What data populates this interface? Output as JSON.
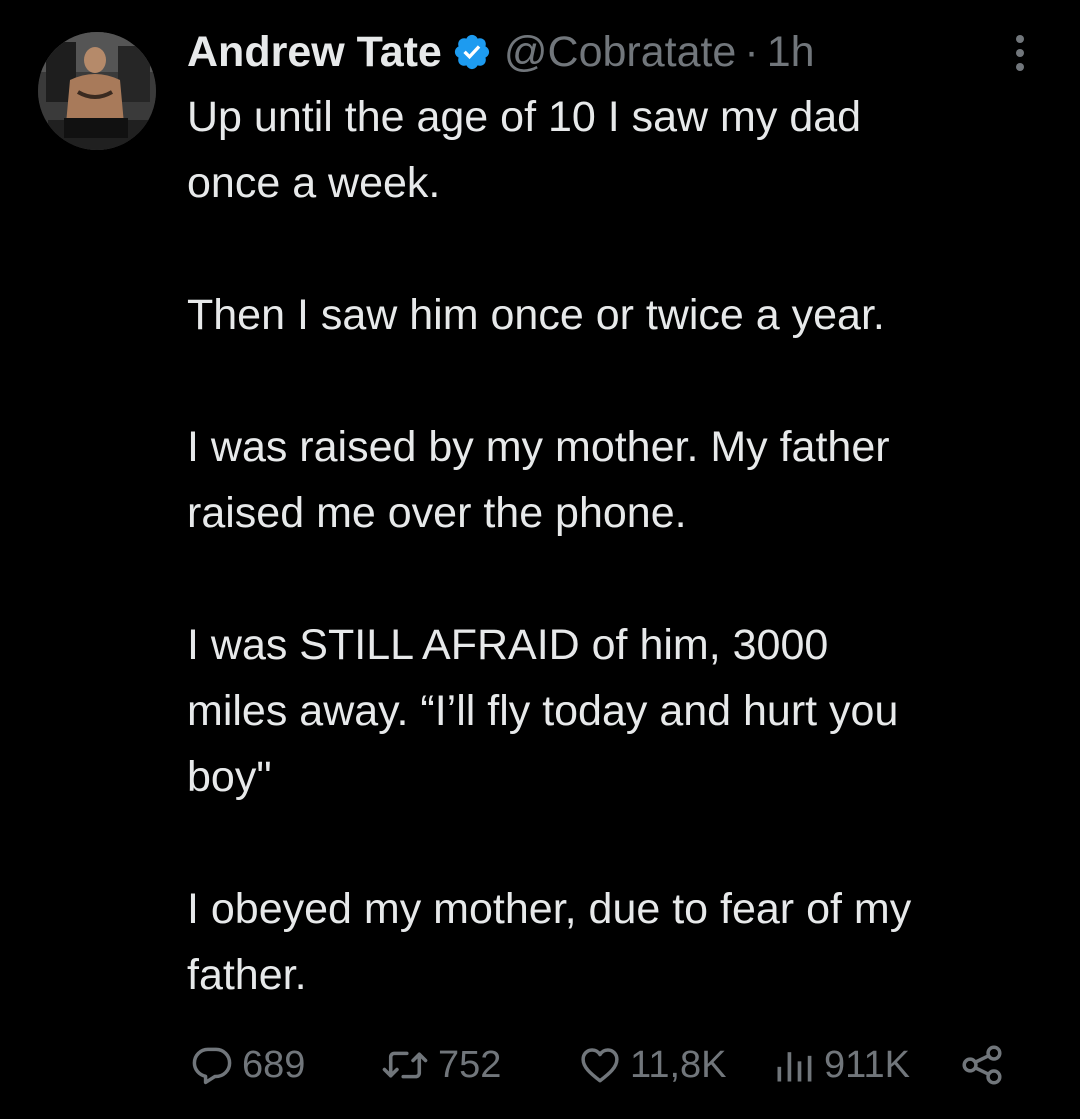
{
  "colors": {
    "background": "#000000",
    "text": "#e7e9ea",
    "secondary": "#71767b",
    "verified": "#1d9bf0"
  },
  "author": {
    "name": "Andrew Tate",
    "handle": "@Cobratate",
    "separator": "·",
    "time": "1h",
    "verified": true,
    "avatar_icon": "profile-photo"
  },
  "body": {
    "paragraphs": [
      "Up until the age of 10 I saw my dad\nonce a week.",
      "Then I saw him once or twice a year.",
      "I was raised by my mother. My father\nraised me over the phone.",
      "I was STILL AFRAID of him, 3000\nmiles away. “I’ll fly today and hurt you\nboy\"",
      "I obeyed my mother, due to fear of my\nfather."
    ]
  },
  "actions": {
    "replies": {
      "icon": "reply-icon",
      "count": "689"
    },
    "retweets": {
      "icon": "retweet-icon",
      "count": "752"
    },
    "likes": {
      "icon": "heart-icon",
      "count": "11,8K"
    },
    "views": {
      "icon": "views-icon",
      "count": "911K"
    },
    "share": {
      "icon": "share-icon"
    }
  }
}
